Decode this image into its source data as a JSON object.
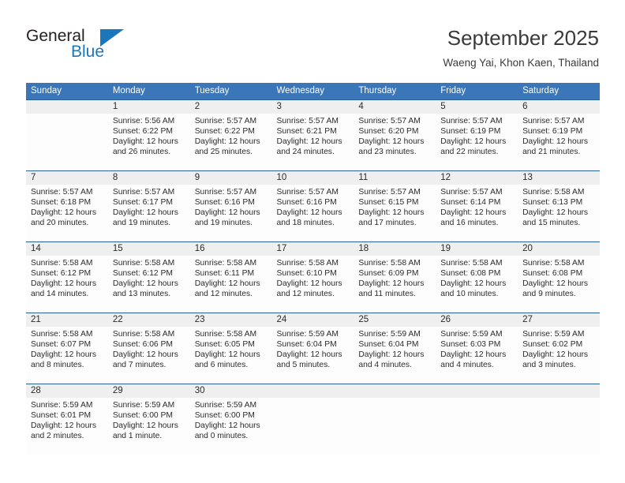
{
  "brand": {
    "name_top": "General",
    "name_bottom": "Blue",
    "triangle_color": "#1b76bc",
    "top_color": "#231f20",
    "bottom_color": "#1b76bc"
  },
  "header": {
    "title": "September 2025",
    "subtitle": "Waeng Yai, Khon Kaen, Thailand"
  },
  "colors": {
    "header_row_bg": "#3a76b8",
    "header_row_text": "#ffffff",
    "week_separator": "#2a6099",
    "daynum_bg": "#efefef",
    "cell_bg": "#fdfdfd",
    "text": "#2b2b2b"
  },
  "calendar": {
    "weekday_headers": [
      "Sunday",
      "Monday",
      "Tuesday",
      "Wednesday",
      "Thursday",
      "Friday",
      "Saturday"
    ],
    "weeks": [
      [
        {
          "day": "",
          "lines": []
        },
        {
          "day": "1",
          "lines": [
            "Sunrise: 5:56 AM",
            "Sunset: 6:22 PM",
            "Daylight: 12 hours",
            "and 26 minutes."
          ]
        },
        {
          "day": "2",
          "lines": [
            "Sunrise: 5:57 AM",
            "Sunset: 6:22 PM",
            "Daylight: 12 hours",
            "and 25 minutes."
          ]
        },
        {
          "day": "3",
          "lines": [
            "Sunrise: 5:57 AM",
            "Sunset: 6:21 PM",
            "Daylight: 12 hours",
            "and 24 minutes."
          ]
        },
        {
          "day": "4",
          "lines": [
            "Sunrise: 5:57 AM",
            "Sunset: 6:20 PM",
            "Daylight: 12 hours",
            "and 23 minutes."
          ]
        },
        {
          "day": "5",
          "lines": [
            "Sunrise: 5:57 AM",
            "Sunset: 6:19 PM",
            "Daylight: 12 hours",
            "and 22 minutes."
          ]
        },
        {
          "day": "6",
          "lines": [
            "Sunrise: 5:57 AM",
            "Sunset: 6:19 PM",
            "Daylight: 12 hours",
            "and 21 minutes."
          ]
        }
      ],
      [
        {
          "day": "7",
          "lines": [
            "Sunrise: 5:57 AM",
            "Sunset: 6:18 PM",
            "Daylight: 12 hours",
            "and 20 minutes."
          ]
        },
        {
          "day": "8",
          "lines": [
            "Sunrise: 5:57 AM",
            "Sunset: 6:17 PM",
            "Daylight: 12 hours",
            "and 19 minutes."
          ]
        },
        {
          "day": "9",
          "lines": [
            "Sunrise: 5:57 AM",
            "Sunset: 6:16 PM",
            "Daylight: 12 hours",
            "and 19 minutes."
          ]
        },
        {
          "day": "10",
          "lines": [
            "Sunrise: 5:57 AM",
            "Sunset: 6:16 PM",
            "Daylight: 12 hours",
            "and 18 minutes."
          ]
        },
        {
          "day": "11",
          "lines": [
            "Sunrise: 5:57 AM",
            "Sunset: 6:15 PM",
            "Daylight: 12 hours",
            "and 17 minutes."
          ]
        },
        {
          "day": "12",
          "lines": [
            "Sunrise: 5:57 AM",
            "Sunset: 6:14 PM",
            "Daylight: 12 hours",
            "and 16 minutes."
          ]
        },
        {
          "day": "13",
          "lines": [
            "Sunrise: 5:58 AM",
            "Sunset: 6:13 PM",
            "Daylight: 12 hours",
            "and 15 minutes."
          ]
        }
      ],
      [
        {
          "day": "14",
          "lines": [
            "Sunrise: 5:58 AM",
            "Sunset: 6:12 PM",
            "Daylight: 12 hours",
            "and 14 minutes."
          ]
        },
        {
          "day": "15",
          "lines": [
            "Sunrise: 5:58 AM",
            "Sunset: 6:12 PM",
            "Daylight: 12 hours",
            "and 13 minutes."
          ]
        },
        {
          "day": "16",
          "lines": [
            "Sunrise: 5:58 AM",
            "Sunset: 6:11 PM",
            "Daylight: 12 hours",
            "and 12 minutes."
          ]
        },
        {
          "day": "17",
          "lines": [
            "Sunrise: 5:58 AM",
            "Sunset: 6:10 PM",
            "Daylight: 12 hours",
            "and 12 minutes."
          ]
        },
        {
          "day": "18",
          "lines": [
            "Sunrise: 5:58 AM",
            "Sunset: 6:09 PM",
            "Daylight: 12 hours",
            "and 11 minutes."
          ]
        },
        {
          "day": "19",
          "lines": [
            "Sunrise: 5:58 AM",
            "Sunset: 6:08 PM",
            "Daylight: 12 hours",
            "and 10 minutes."
          ]
        },
        {
          "day": "20",
          "lines": [
            "Sunrise: 5:58 AM",
            "Sunset: 6:08 PM",
            "Daylight: 12 hours",
            "and 9 minutes."
          ]
        }
      ],
      [
        {
          "day": "21",
          "lines": [
            "Sunrise: 5:58 AM",
            "Sunset: 6:07 PM",
            "Daylight: 12 hours",
            "and 8 minutes."
          ]
        },
        {
          "day": "22",
          "lines": [
            "Sunrise: 5:58 AM",
            "Sunset: 6:06 PM",
            "Daylight: 12 hours",
            "and 7 minutes."
          ]
        },
        {
          "day": "23",
          "lines": [
            "Sunrise: 5:58 AM",
            "Sunset: 6:05 PM",
            "Daylight: 12 hours",
            "and 6 minutes."
          ]
        },
        {
          "day": "24",
          "lines": [
            "Sunrise: 5:59 AM",
            "Sunset: 6:04 PM",
            "Daylight: 12 hours",
            "and 5 minutes."
          ]
        },
        {
          "day": "25",
          "lines": [
            "Sunrise: 5:59 AM",
            "Sunset: 6:04 PM",
            "Daylight: 12 hours",
            "and 4 minutes."
          ]
        },
        {
          "day": "26",
          "lines": [
            "Sunrise: 5:59 AM",
            "Sunset: 6:03 PM",
            "Daylight: 12 hours",
            "and 4 minutes."
          ]
        },
        {
          "day": "27",
          "lines": [
            "Sunrise: 5:59 AM",
            "Sunset: 6:02 PM",
            "Daylight: 12 hours",
            "and 3 minutes."
          ]
        }
      ],
      [
        {
          "day": "28",
          "lines": [
            "Sunrise: 5:59 AM",
            "Sunset: 6:01 PM",
            "Daylight: 12 hours",
            "and 2 minutes."
          ]
        },
        {
          "day": "29",
          "lines": [
            "Sunrise: 5:59 AM",
            "Sunset: 6:00 PM",
            "Daylight: 12 hours",
            "and 1 minute."
          ]
        },
        {
          "day": "30",
          "lines": [
            "Sunrise: 5:59 AM",
            "Sunset: 6:00 PM",
            "Daylight: 12 hours",
            "and 0 minutes."
          ]
        },
        {
          "day": "",
          "lines": []
        },
        {
          "day": "",
          "lines": []
        },
        {
          "day": "",
          "lines": []
        },
        {
          "day": "",
          "lines": []
        }
      ]
    ]
  }
}
